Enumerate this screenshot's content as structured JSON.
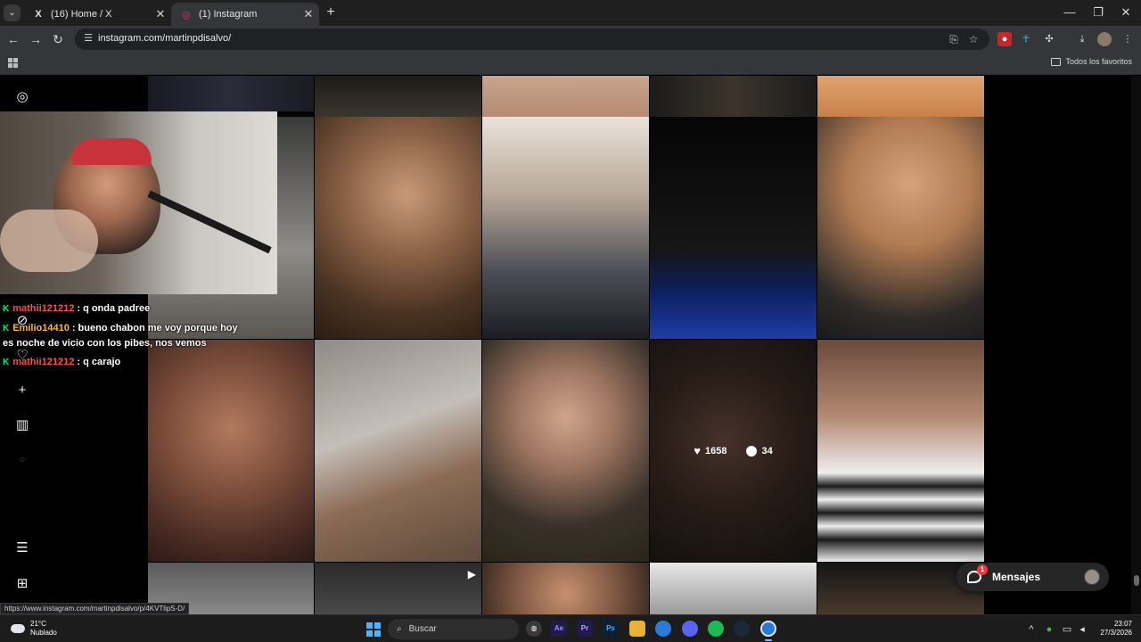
{
  "browser": {
    "tabs": [
      {
        "title": "(16) Home / X",
        "icon": "x-icon"
      },
      {
        "title": "(1) Instagram",
        "icon": "instagram-icon",
        "active": true
      }
    ],
    "url": "instagram.com/martinpdisalvo/",
    "bookmarks_all": "Todos los favoritos"
  },
  "posts": {
    "hovered": {
      "likes": "1658",
      "comments": "34"
    }
  },
  "chat": [
    {
      "user": "mathii121212",
      "user_color": "#ff4d4d",
      "text": ": q onda padree"
    },
    {
      "user": "Emilio14410",
      "user_color": "#ffb347",
      "text": ": bueno chabon me voy porque hoy",
      "continuation": "es noche de vicio con los pibes, nos vemos"
    },
    {
      "user": "mathii121212",
      "user_color": "#ff4d4d",
      "text": ": q carajo"
    }
  ],
  "messages": {
    "label": "Mensajes",
    "count": "1"
  },
  "status_url": "https://www.instagram.com/martinpdisalvo/p/4KVTlipS-D/",
  "taskbar": {
    "weather_temp": "21°C",
    "weather_desc": "Nublado",
    "search_placeholder": "Buscar",
    "time": "23:07",
    "date": "27/3/2026"
  }
}
